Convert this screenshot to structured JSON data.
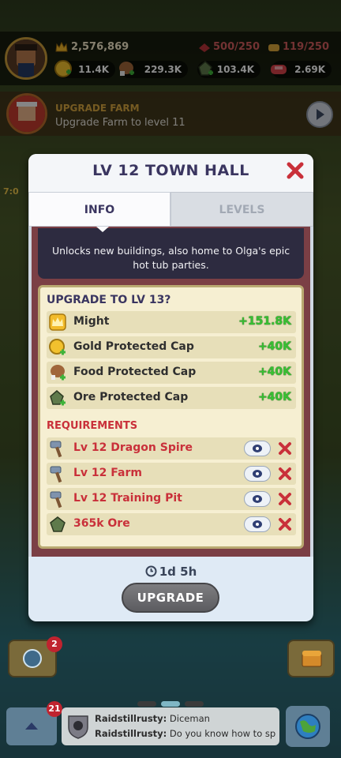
{
  "top_bar": {
    "might": "2,576,869",
    "troops": "500/250",
    "capacity": "119/250",
    "gold": "11.4K",
    "food": "229.3K",
    "ore": "103.4K",
    "meat": "2.69K"
  },
  "quest": {
    "title": "UPGRADE FARM",
    "subtitle": "Upgrade Farm to level 11"
  },
  "side_hint": "7:0",
  "modal": {
    "title": "LV 12 TOWN HALL",
    "tabs": [
      "INFO",
      "LEVELS"
    ],
    "description": "Unlocks new buildings, also home to Olga's epic hot tub parties.",
    "upgrade_heading": "UPGRADE TO LV 13?",
    "benefits": [
      {
        "icon": "crown-icon",
        "label": "Might",
        "value": "+151.8K"
      },
      {
        "icon": "gold-icon",
        "label": "Gold Protected Cap",
        "value": "+40K"
      },
      {
        "icon": "food-icon",
        "label": "Food Protected Cap",
        "value": "+40K"
      },
      {
        "icon": "ore-icon",
        "label": "Ore Protected Cap",
        "value": "+40K"
      }
    ],
    "requirements_heading": "REQUIREMENTS",
    "requirements": [
      {
        "icon": "hammer-icon",
        "label": "Lv 12 Dragon Spire"
      },
      {
        "icon": "hammer-icon",
        "label": "Lv 12 Farm"
      },
      {
        "icon": "hammer-icon",
        "label": "Lv 12 Training Pit"
      },
      {
        "icon": "ore-icon",
        "label": "365k Ore"
      }
    ],
    "timer": "1d 5h",
    "upgrade_label": "UPGRADE"
  },
  "bottom": {
    "badge_left": "2",
    "badge_chat": "21",
    "chat": [
      {
        "user": "Raidstillrusty:",
        "text": "Diceman"
      },
      {
        "user": "Raidstillrusty:",
        "text": "Do you know how to sp"
      }
    ]
  },
  "colors": {
    "title": "#3a3560",
    "requirement_text": "#c9303a",
    "positive": "#38c032",
    "panel_bg": "#f6efd2"
  }
}
